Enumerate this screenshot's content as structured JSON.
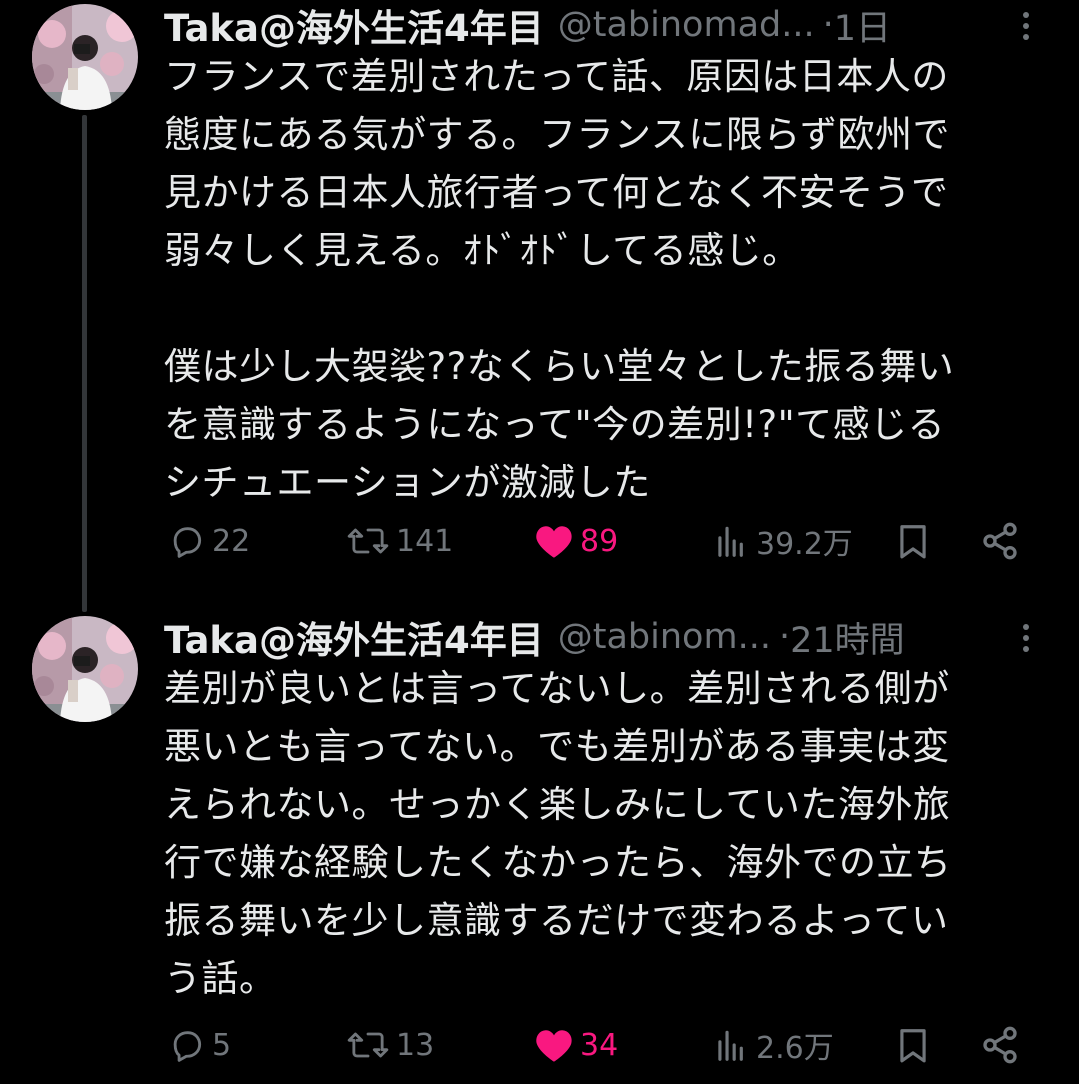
{
  "tweets": [
    {
      "author_name": "Taka@海外生活4年目",
      "author_handle": "@tabinomad...",
      "separator": "·",
      "time": "1日",
      "text": "フランスで差別されたって話、原因は日本人の\n態度にある気がする。フランスに限らず欧州で\n見かける日本人旅行者って何となく不安そうで\n弱々しく見える。ｵﾄﾞｵﾄﾞしてる感じ。\n\n僕は少し大袈裟??なくらい堂々とした振る舞い\nを意識するようになって\"今の差別!?\"て感じる\nシチュエーションが激減した",
      "replies": "22",
      "retweets": "141",
      "likes": "89",
      "views": "39.2万",
      "liked": true
    },
    {
      "author_name": "Taka@海外生活4年目",
      "author_handle": "@tabinom...",
      "separator": "·",
      "time": "21時間",
      "text": "差別が良いとは言ってないし。差別される側が\n悪いとも言ってない。でも差別がある事実は変\nえられない。せっかく楽しみにしていた海外旅\n行で嫌な経験したくなかったら、海外での立ち\n振る舞いを少し意識するだけで変わるよってい\nう話。",
      "replies": "5",
      "retweets": "13",
      "likes": "34",
      "views": "2.6万",
      "liked": true
    }
  ],
  "icons": {
    "reply": "speech-bubble-icon",
    "retweet": "retweet-arrows-icon",
    "like": "heart-icon",
    "views": "bar-chart-icon",
    "bookmark": "bookmark-icon",
    "share": "share-icon",
    "more": "more-vertical-icon"
  },
  "colors": {
    "background": "#000000",
    "text": "#e7e9ea",
    "muted": "#71767b",
    "like": "#f91880",
    "thread_line": "#333639"
  }
}
